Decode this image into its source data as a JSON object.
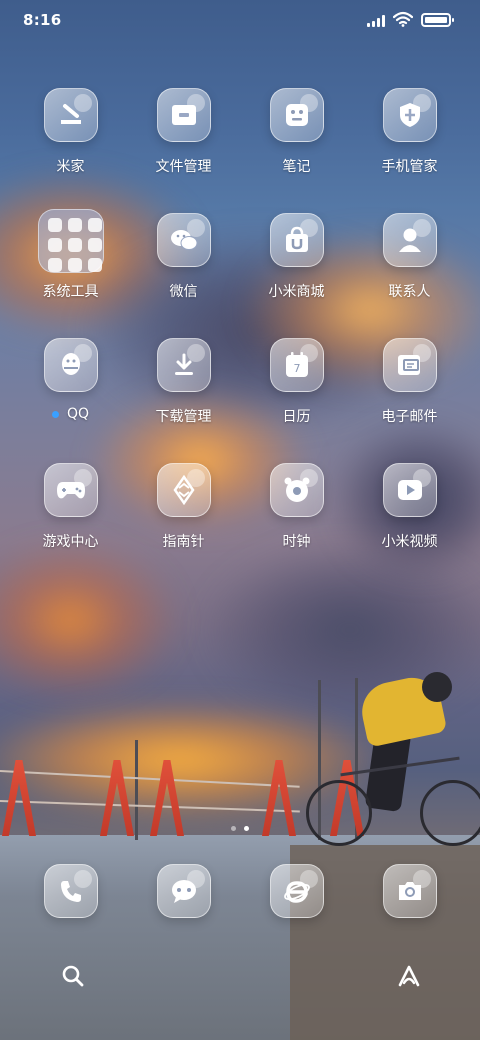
{
  "status_bar": {
    "time": "8:16",
    "icons": [
      "signal-icon",
      "wifi-icon",
      "battery-icon"
    ]
  },
  "apps": [
    {
      "label": "米家",
      "icon": "mi-home-icon"
    },
    {
      "label": "文件管理",
      "icon": "file-manager-icon"
    },
    {
      "label": "笔记",
      "icon": "notes-icon"
    },
    {
      "label": "手机管家",
      "icon": "security-shield-icon"
    },
    {
      "label": "系统工具",
      "icon": "folder-icon"
    },
    {
      "label": "微信",
      "icon": "wechat-icon"
    },
    {
      "label": "小米商城",
      "icon": "mi-store-icon"
    },
    {
      "label": "联系人",
      "icon": "contacts-icon"
    },
    {
      "label": "QQ",
      "icon": "qq-penguin-icon"
    },
    {
      "label": "下载管理",
      "icon": "download-icon"
    },
    {
      "label": "日历",
      "icon": "calendar-icon",
      "date": "7"
    },
    {
      "label": "电子邮件",
      "icon": "email-icon"
    },
    {
      "label": "游戏中心",
      "icon": "gamepad-icon"
    },
    {
      "label": "指南针",
      "icon": "compass-icon"
    },
    {
      "label": "时钟",
      "icon": "clock-icon"
    },
    {
      "label": "小米视频",
      "icon": "video-play-icon"
    }
  ],
  "dock": [
    {
      "icon": "phone-icon"
    },
    {
      "icon": "messages-icon"
    },
    {
      "icon": "browser-icon"
    },
    {
      "icon": "camera-icon"
    }
  ],
  "page_indicator": {
    "pages": 2,
    "current": 2
  },
  "bottom": {
    "left_icon": "search-icon",
    "right_icon": "assistant-icon"
  },
  "colors": {
    "notification_dot": "#3aa0ff"
  }
}
